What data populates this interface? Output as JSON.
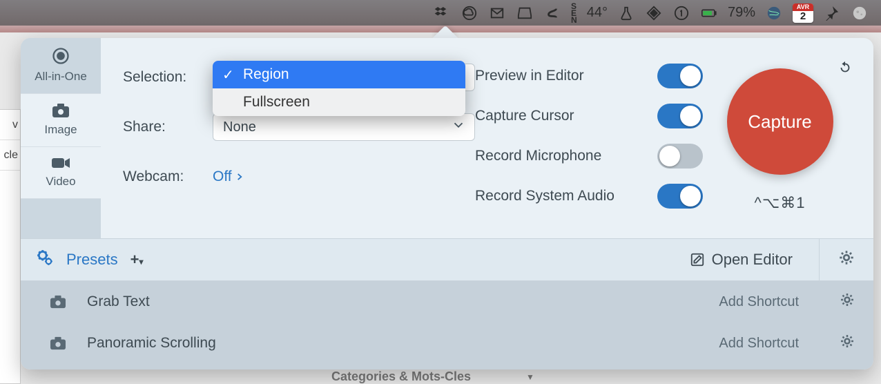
{
  "menubar": {
    "temperature": "44°",
    "battery_pct": "79%",
    "calendar_month": "AVR",
    "calendar_day": "2"
  },
  "bg_prefs": {
    "row1": "v",
    "row2": "cle"
  },
  "bg_page": {
    "text": "Categories & Mots-Cles"
  },
  "tabs": {
    "allinone": "All-in-One",
    "image": "Image",
    "video": "Video"
  },
  "labels": {
    "selection": "Selection:",
    "share": "Share:",
    "webcam": "Webcam:"
  },
  "values": {
    "share": "None",
    "webcam": "Off"
  },
  "dropdown": {
    "region": "Region",
    "fullscreen": "Fullscreen"
  },
  "toggles": {
    "preview": "Preview in Editor",
    "cursor": "Capture Cursor",
    "mic": "Record Microphone",
    "audio": "Record System Audio"
  },
  "capture": {
    "button": "Capture",
    "shortcut": "^⌥⌘1"
  },
  "presets_bar": {
    "label": "Presets",
    "open_editor": "Open Editor"
  },
  "presets": [
    {
      "name": "Grab Text",
      "shortcut": "Add Shortcut"
    },
    {
      "name": "Panoramic Scrolling",
      "shortcut": "Add Shortcut"
    }
  ]
}
